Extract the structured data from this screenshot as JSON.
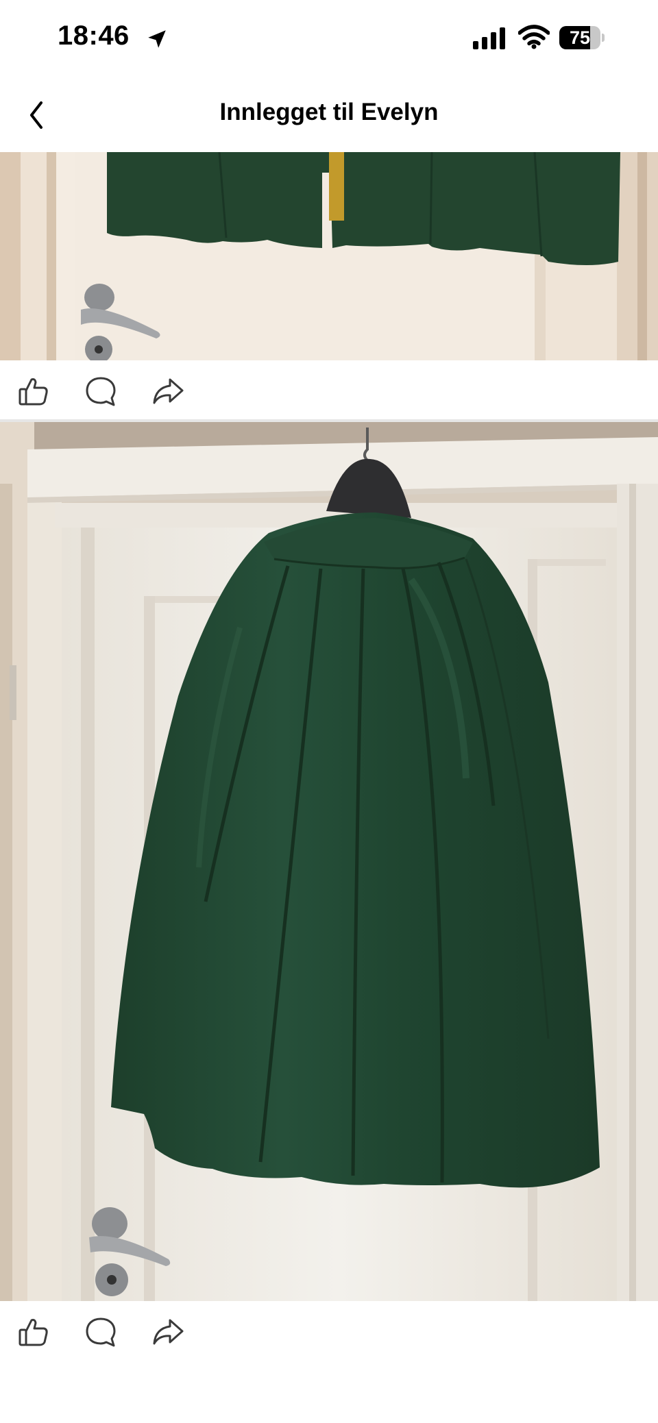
{
  "status_bar": {
    "time": "18:46",
    "battery_level": "75",
    "icons": [
      "location-arrow-icon",
      "cellular-signal-icon",
      "wifi-icon",
      "battery-icon"
    ]
  },
  "nav": {
    "title": "Innlegget til Evelyn",
    "back_icon": "chevron-left-icon"
  },
  "posts": [
    {
      "image": "green-pleated-skirt-hem-photo",
      "actions": [
        "like-icon",
        "comment-icon",
        "share-icon"
      ]
    },
    {
      "image": "green-pleated-skirt-on-hanger-photo",
      "actions": [
        "like-icon",
        "comment-icon",
        "share-icon"
      ]
    }
  ],
  "colors": {
    "skirt_green": "#1f4a32",
    "door_cream": "#efe6da",
    "icon_gray": "#3a3a3a"
  }
}
